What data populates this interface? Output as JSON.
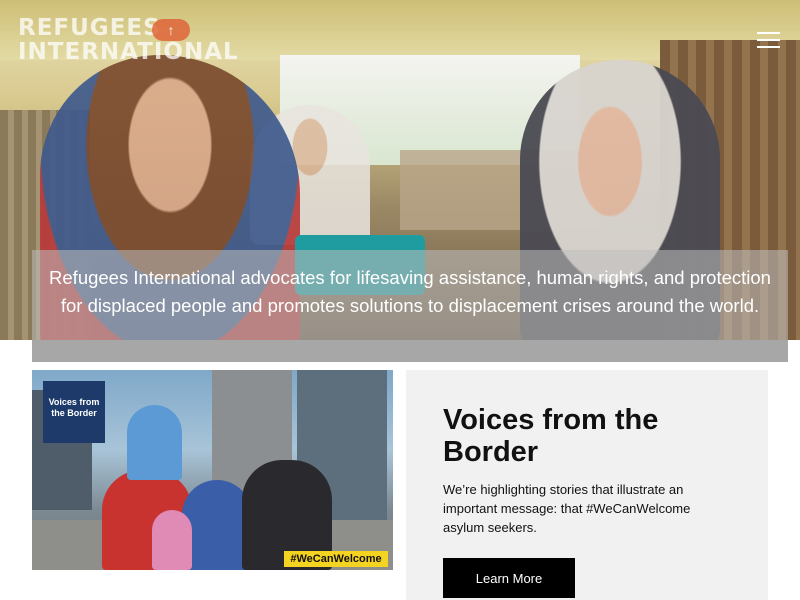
{
  "logo": {
    "line1": "REFUGEES",
    "line2": "INTERNATIONAL",
    "badge_glyph": "↑"
  },
  "header": {
    "menu_icon": "hamburger-menu-icon"
  },
  "hero": {
    "mission": "Refugees International advocates for lifesaving assistance, human rights, and protection for displaced people and promotes solutions to displacement crises around the world."
  },
  "promo": {
    "image_badge": "Voices from the Border",
    "image_hashtag": "#WeCanWelcome",
    "title": "Voices from the Border",
    "description": "We’re highlighting stories that illustrate an important message: that #WeCanWelcome asylum seekers.",
    "button_label": "Learn More"
  },
  "colors": {
    "logo_badge": "#e0663a",
    "button": "#000000",
    "card_background": "#f1f1f1",
    "hashtag_badge": "#f4d321"
  }
}
